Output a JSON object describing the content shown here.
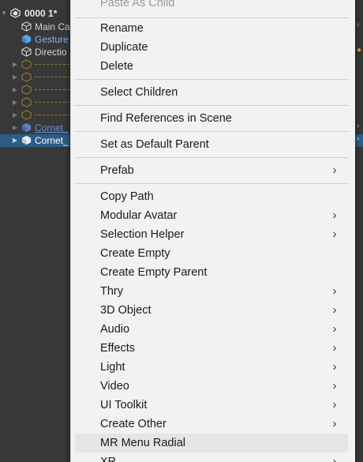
{
  "hierarchy": {
    "root_label": "0000 1*",
    "rows": [
      {
        "label": "Main Ca",
        "style": "normal"
      },
      {
        "label": "Gesture",
        "style": "blue"
      },
      {
        "label": "Directio",
        "style": "normal"
      },
      {
        "label": "Cornet_",
        "style": "prefab"
      },
      {
        "label": "Cornet_",
        "style": "selected"
      }
    ]
  },
  "menu": {
    "items": [
      {
        "label": "Paste As Child",
        "disabled": true
      },
      {
        "label": "Rename"
      },
      {
        "label": "Duplicate"
      },
      {
        "label": "Delete"
      },
      {
        "label": "Select Children"
      },
      {
        "label": "Find References in Scene"
      },
      {
        "label": "Set as Default Parent"
      },
      {
        "label": "Prefab",
        "submenu": true
      },
      {
        "label": "Copy Path"
      },
      {
        "label": "Modular Avatar",
        "submenu": true
      },
      {
        "label": "Selection Helper",
        "submenu": true
      },
      {
        "label": "Create Empty"
      },
      {
        "label": "Create Empty Parent"
      },
      {
        "label": "Thry",
        "submenu": true
      },
      {
        "label": "3D Object",
        "submenu": true
      },
      {
        "label": "Audio",
        "submenu": true
      },
      {
        "label": "Effects",
        "submenu": true
      },
      {
        "label": "Light",
        "submenu": true
      },
      {
        "label": "Video",
        "submenu": true
      },
      {
        "label": "UI Toolkit",
        "submenu": true
      },
      {
        "label": "Create Other",
        "submenu": true
      },
      {
        "label": "MR Menu Radial",
        "hovered": true
      },
      {
        "label": "XR",
        "submenu": true
      }
    ],
    "chevron_glyph": "›"
  },
  "colors": {
    "menu_bg": "#f2f2f2",
    "hover_bg": "#e5e5e5",
    "selection_blue": "#2c5d87",
    "hierarchy_bg": "#383838"
  }
}
